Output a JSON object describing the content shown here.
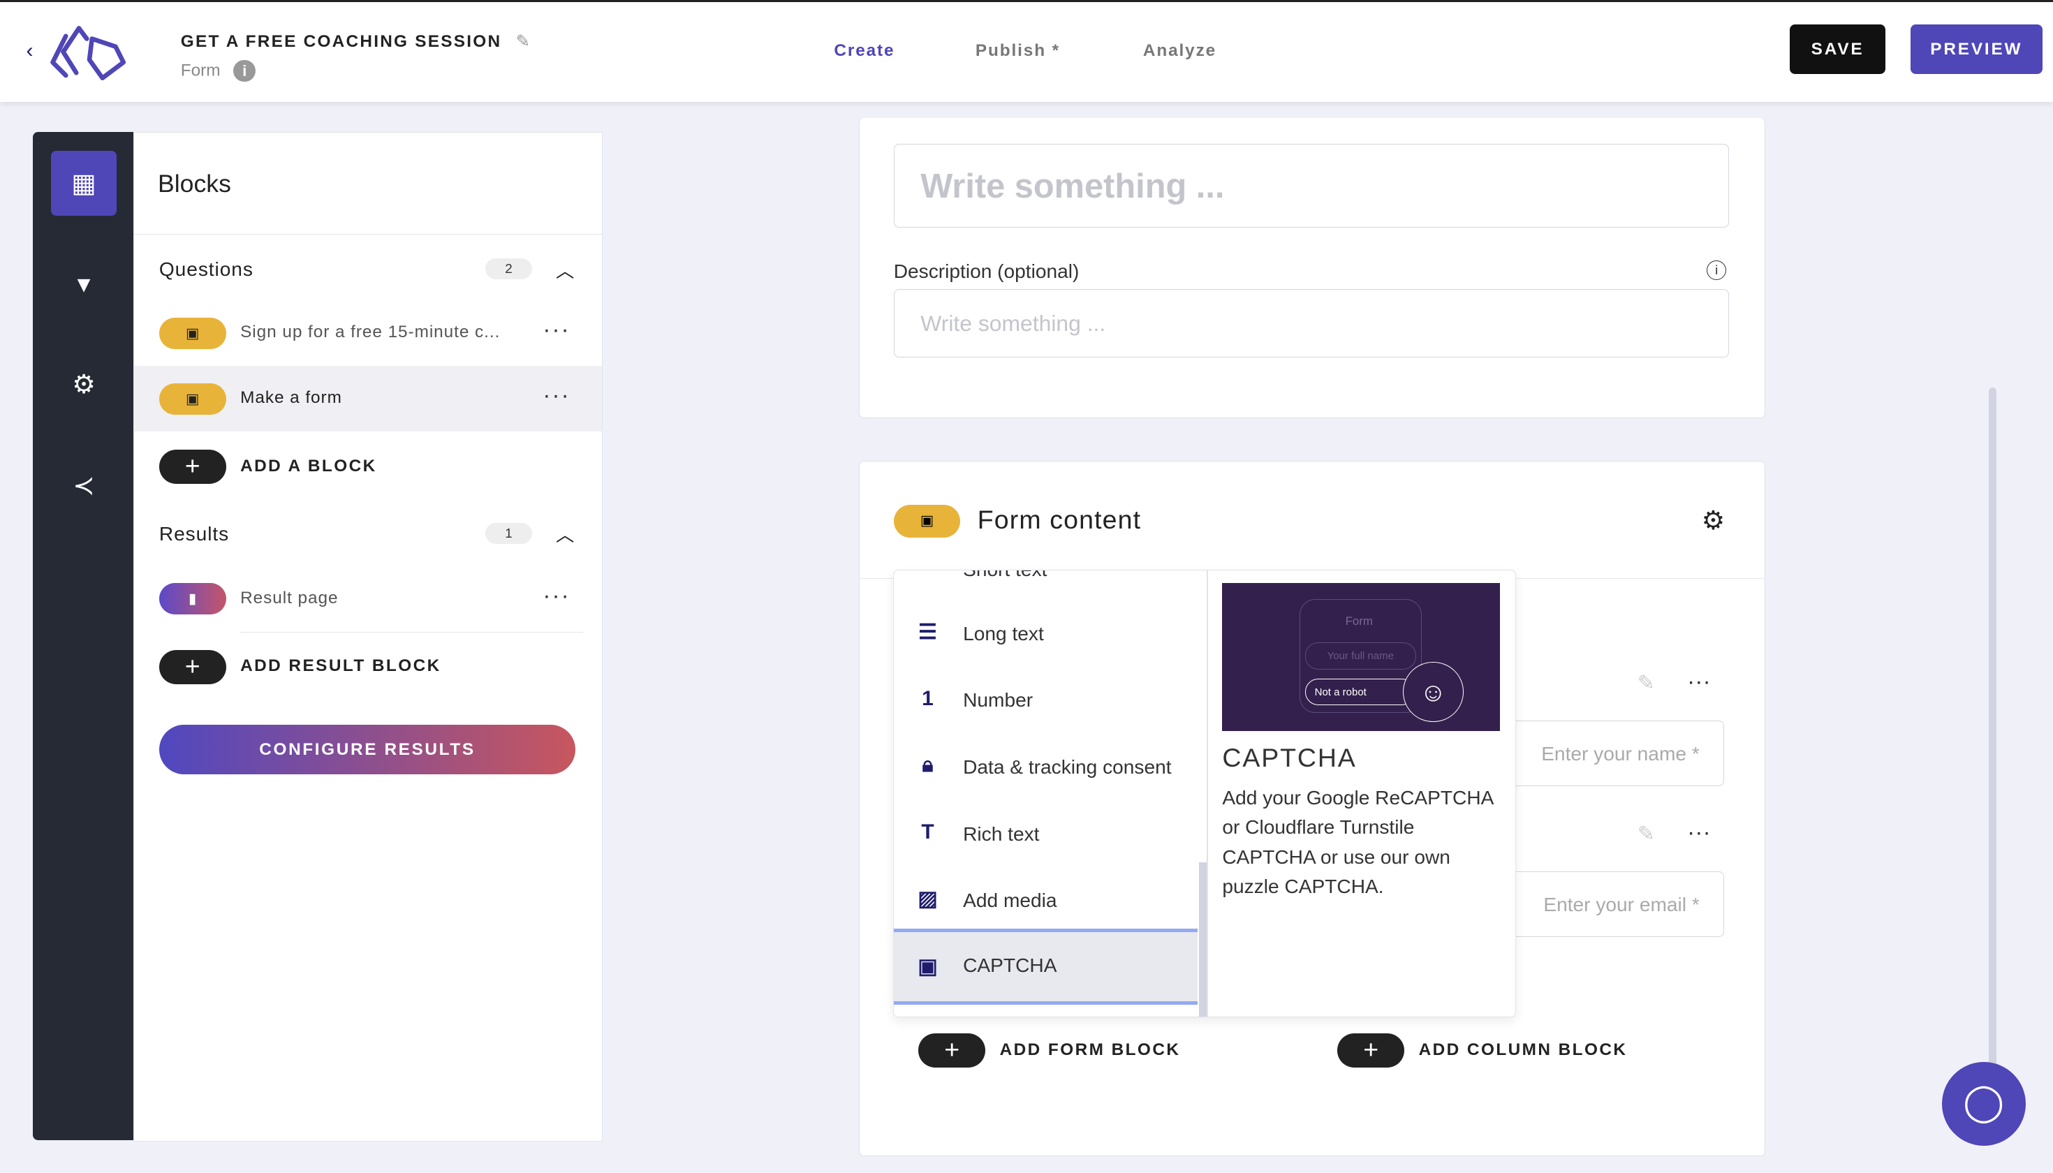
{
  "header": {
    "back_icon": "chevron-left-icon",
    "title": "GET A FREE COACHING SESSION",
    "subtitle": "Form",
    "tabs": [
      {
        "label": "Create",
        "active": true
      },
      {
        "label": "Publish *",
        "active": false
      },
      {
        "label": "Analyze",
        "active": false
      }
    ],
    "save_label": "SAVE",
    "preview_label": "PREVIEW"
  },
  "colors": {
    "accent": "#4f46b8",
    "pill_yellow": "#e8b339",
    "rail": "#262a35"
  },
  "rail": [
    "blocks-grid-icon",
    "paintbrush-icon",
    "gear-icon",
    "share-icon"
  ],
  "blocks": {
    "title": "Blocks",
    "questions": {
      "label": "Questions",
      "count": "2",
      "items": [
        {
          "label": "Sign up for a free 15-minute c..."
        },
        {
          "label": "Make a form"
        }
      ],
      "add_label": "ADD A BLOCK"
    },
    "results": {
      "label": "Results",
      "count": "1",
      "items": [
        {
          "label": "Result page"
        }
      ],
      "add_label": "ADD RESULT BLOCK"
    },
    "configure_label": "CONFIGURE RESULTS"
  },
  "editor": {
    "title_placeholder": "Write something ...",
    "description_label": "Description (optional)",
    "description_placeholder": "Write something ...",
    "form_content_title": "Form content",
    "name_placeholder": "Enter your name *",
    "email_placeholder": "Enter your email *",
    "add_form_block": "ADD FORM BLOCK",
    "add_column_block": "ADD COLUMN BLOCK"
  },
  "block_menu": {
    "partial_item": "Short text",
    "items": [
      {
        "label": "Long text",
        "icon": "long-text-icon"
      },
      {
        "label": "Number",
        "icon": "number-icon"
      },
      {
        "label": "Data & tracking consent",
        "icon": "lock-icon"
      },
      {
        "label": "Rich text",
        "icon": "text-icon"
      },
      {
        "label": "Add media",
        "icon": "image-icon"
      },
      {
        "label": "CAPTCHA",
        "icon": "robot-icon"
      }
    ],
    "preview": {
      "image_form": "Form",
      "image_field": "Your full name",
      "image_button": "Not a robot",
      "title": "CAPTCHA",
      "description": "Add your Google ReCAPTCHA or Cloudflare Turnstile CAPTCHA or use our own puzzle CAPTCHA."
    }
  }
}
